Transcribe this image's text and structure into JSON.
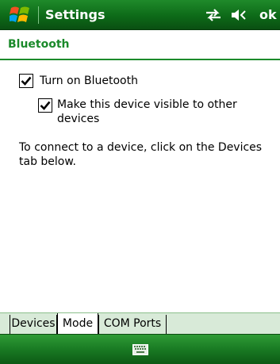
{
  "titlebar": {
    "app_title": "Settings",
    "ok_label": "ok",
    "icons": [
      "windows-start-icon",
      "connectivity-icon",
      "volume-icon"
    ]
  },
  "page": {
    "heading": "Bluetooth"
  },
  "options": {
    "turn_on": {
      "label": "Turn on Bluetooth",
      "checked": true
    },
    "visible": {
      "label": "Make this device visible to other devices",
      "checked": true
    }
  },
  "info_text": "To connect to a device, click on the Devices tab below.",
  "tabs": [
    {
      "label": "Devices",
      "active": false
    },
    {
      "label": "Mode",
      "active": true
    },
    {
      "label": "COM Ports",
      "active": false
    }
  ],
  "menubar": {
    "icon": "keyboard-icon"
  },
  "colors": {
    "accent": "#1b8a2b",
    "titlebar": "#0d6a18",
    "tabstrip": "#d8ead8"
  }
}
